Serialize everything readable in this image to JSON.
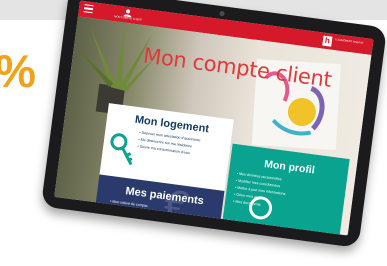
{
  "header": {
    "account_label": "MON COMPTE CLIENT",
    "brand_logo": "h",
    "brand_name": "LOGIRÉMENT HABITAT"
  },
  "hero": {
    "title": "Mon compte client"
  },
  "logement": {
    "title": "Mon logement",
    "items": [
      "Déposer mon attestation d'assurance",
      "Me désinscrire sur ma résidence",
      "Suivre ma consommation d'eau"
    ]
  },
  "paiements": {
    "title": "Mes paiements",
    "items": [
      "Mon relevé de compte",
      "Payer mon loyer en ligne"
    ]
  },
  "profil": {
    "title": "Mon profil",
    "items": [
      "Mes données personnelles",
      "Modifier mes coordonnées",
      "Mettre à jour mes informations",
      "Gérer mes alertes",
      "Mes documents"
    ]
  },
  "decor": {
    "side_glyph": "%"
  },
  "colors": {
    "brand_red": "#d5192b",
    "navy": "#2b3a6d",
    "teal": "#0aa38f",
    "accent_orange": "#f1a218"
  }
}
